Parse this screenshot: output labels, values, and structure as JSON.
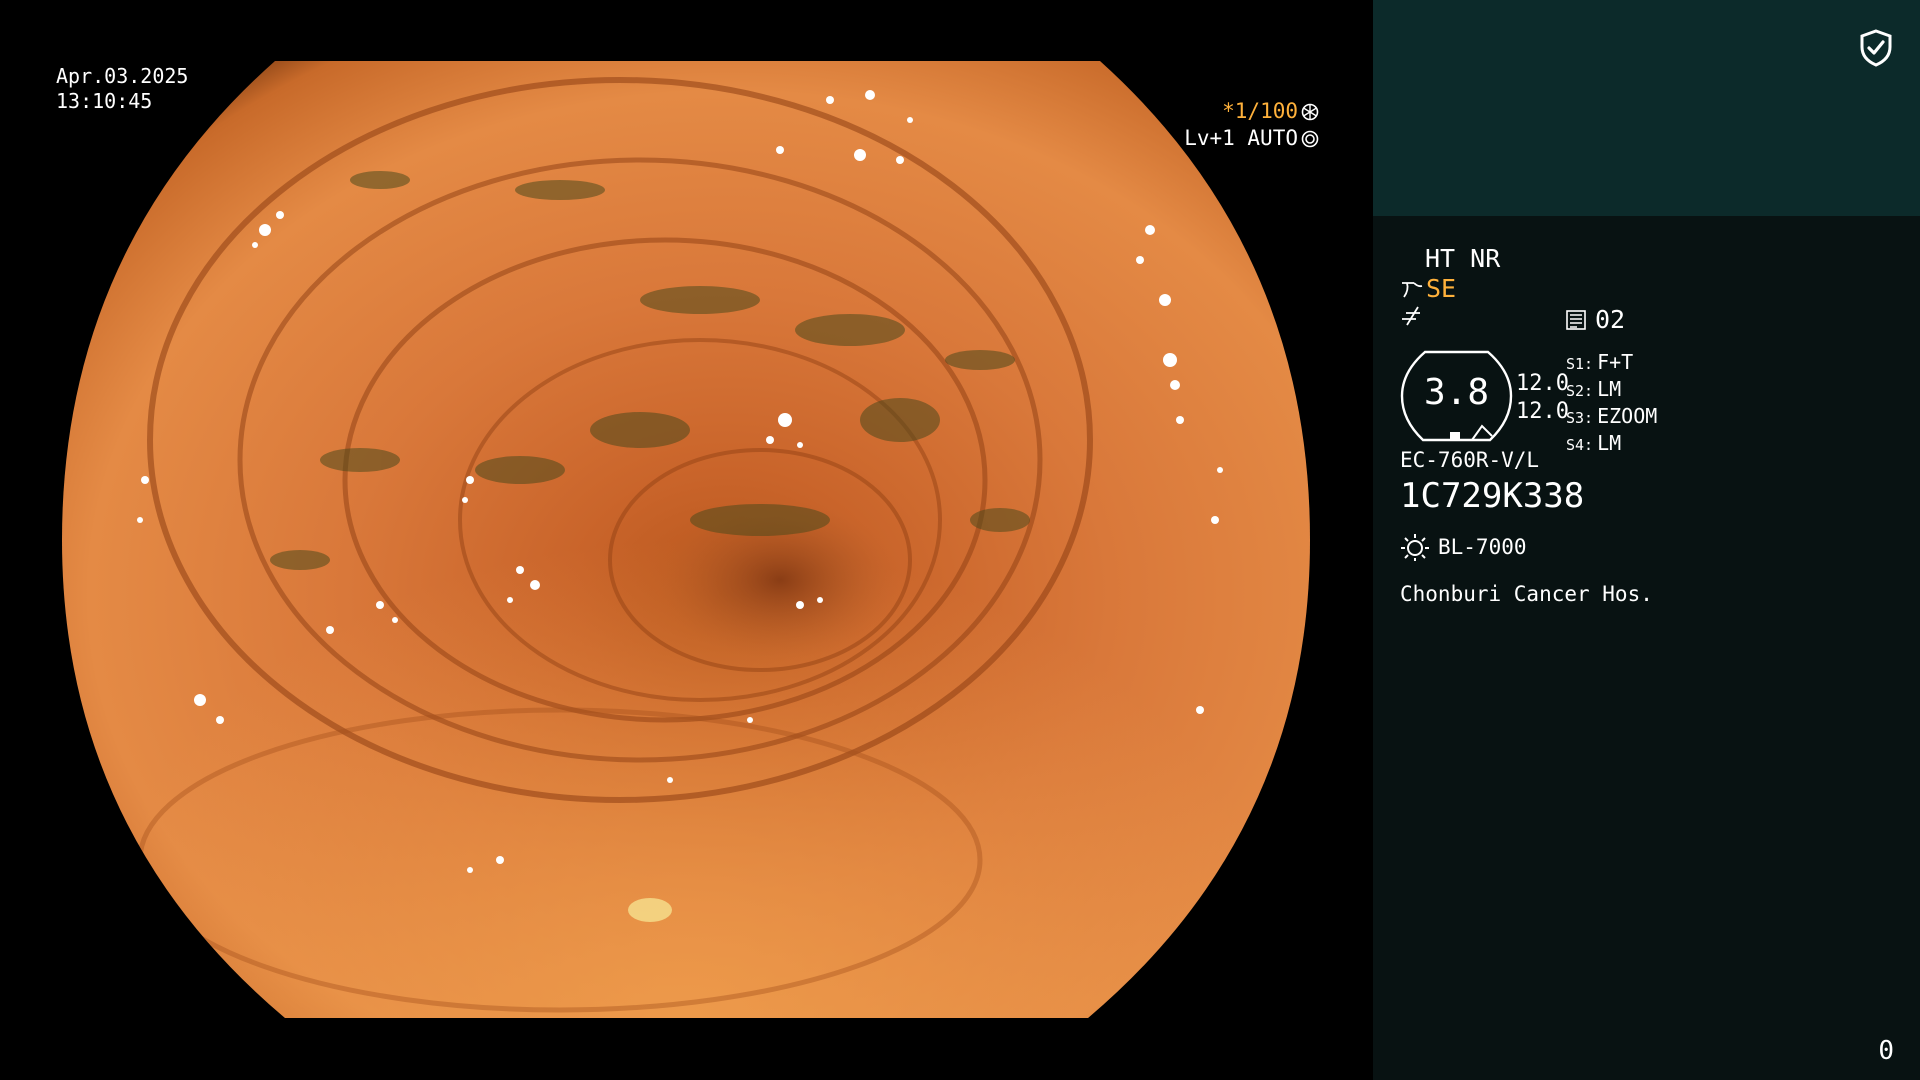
{
  "video": {
    "date": "Apr.03.2025",
    "time": "13:10:45",
    "shutter": "*1/100",
    "level": "Lv+1 AUTO"
  },
  "panel": {
    "mode": "HT NR",
    "enhance": "SE",
    "memo_number": "02",
    "gauge_value": "3.8",
    "values": [
      "12.0",
      "12.0"
    ],
    "switches": [
      {
        "key": "S1:",
        "value": "F+T"
      },
      {
        "key": "S2:",
        "value": "LM"
      },
      {
        "key": "S3:",
        "value": "EZOOM"
      },
      {
        "key": "S4:",
        "value": "LM"
      }
    ],
    "scope_model": "EC-760R-V/L",
    "scope_serial": "1C729K338",
    "light_source": "BL-7000",
    "hospital": "Chonburi Cancer Hos.",
    "counter": "0"
  },
  "colors": {
    "accent_orange": "#ffb13b",
    "panel_top": "#0c2a2a",
    "panel_bottom": "#081212"
  },
  "icons": [
    "shield-check-icon",
    "shutter-icon",
    "iris-icon",
    "enhance-icon",
    "sharpness-icon",
    "memo-icon",
    "lamp-icon"
  ]
}
